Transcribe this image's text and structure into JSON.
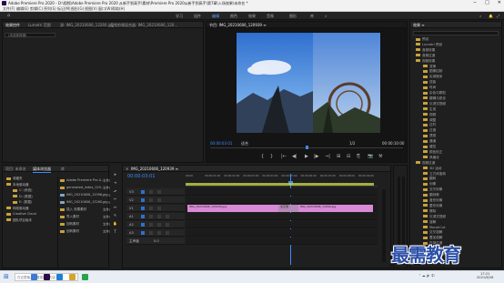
{
  "window": {
    "title": "Adobe Premiere Pro 2020 - D:\\视频\\Adobe Premiere Pro 2020 从新手到高手\\素材\\Premiere Pro 2020从新手到高手\\第7章\\入场效果\\未命名 *"
  },
  "menu": [
    "文件(F)",
    "编辑(E)",
    "剪辑(C)",
    "序列(S)",
    "标记(M)",
    "图形(G)",
    "视图(V)",
    "窗口(W)",
    "帮助(H)"
  ],
  "workspaces": [
    "学习",
    "组件",
    "编辑",
    "颜色",
    "效果",
    "音频",
    "图形",
    "库"
  ],
  "workspaces_more": "»",
  "source_panel": {
    "tabs": [
      "效果控件",
      "Lumetri 范围",
      "源: IMG_20210606_13260.jpg",
      "音频剪辑混合器: IMG_20210606_120..."
    ],
    "placeholder": "(未选择剪辑)"
  },
  "program_monitor": {
    "title": "节目: IMG_20210606_120939 ≡",
    "timecode_left": "00:00:03:01",
    "fit": "适合",
    "ratio": "1/2",
    "timecode_right": "00:00:10:00"
  },
  "transport": [
    "{",
    "}",
    "|←",
    "◀|",
    "▶",
    "|▶",
    "→|",
    "⊞",
    "⊟",
    "⎘",
    "📷",
    "⚒"
  ],
  "project_panel": {
    "tabs": [
      "项目: 未命名",
      "媒体浏览器",
      "库"
    ],
    "sidebar": [
      "收藏夹",
      "本地驱动器",
      "C: (系统)",
      "D: (数据)",
      "E: (数据)",
      "网络驱动器",
      "Creative Cloud",
      "团队项目版本"
    ],
    "files": [
      {
        "name": "Adobe Premiere Pro A...",
        "type": "文件夹"
      },
      {
        "name": "generated_index_120...",
        "type": "文件夹"
      },
      {
        "name": "IMG_20210606_12096...",
        "type": "JPEG"
      },
      {
        "name": "IMG_20210606_13260...",
        "type": "JPEG"
      },
      {
        "name": "插入 效果素材",
        "type": "文件夹"
      },
      {
        "name": "导入素材",
        "type": "文件夹"
      },
      {
        "name": "回转素材",
        "type": "文件夹"
      },
      {
        "name": "回转素材",
        "type": "文件夹"
      }
    ],
    "col_type": "文件夹"
  },
  "timeline": {
    "tab": "IMG_20210606_120939 ≡",
    "timecode": "00:00:03:01",
    "ruler": [
      "00:00",
      "00:00:01:00",
      "00:00:02:00",
      "00:00:03:00",
      "00:00:04:00",
      "00:00:05:00",
      "00:00:06:00",
      "00:00:07:00",
      "00:00:08:00",
      "00:00:09:00"
    ],
    "tracks": [
      "V3",
      "V2",
      "V1",
      "A1",
      "A2",
      "A3",
      "主声道"
    ],
    "master_value": "0.0",
    "clips": [
      {
        "label": "IMG_20210606_120939.jpg",
        "track": "V1"
      },
      {
        "label": "IMG_20210606_13260.jpg",
        "track": "V1"
      }
    ],
    "transition_label": "交叉溶"
  },
  "effects_panel": {
    "title": "效果 ≡",
    "items": [
      "预设",
      "Lumetri 预设",
      "音频效果",
      "音频过渡",
      "视频效果",
      "变换",
      "图像控制",
      "实用程序",
      "扭曲",
      "时间",
      "杂色与颗粒",
      "模糊与锐化",
      "沉浸式视频",
      "生成",
      "视频",
      "调整",
      "过时",
      "过渡",
      "透视",
      "通道",
      "键控",
      "颜色校正",
      "风格化",
      "视频过渡",
      "3D 运动",
      "立方体旋转",
      "翻转",
      "划像",
      "交叉划像",
      "圆划像",
      "盒形划像",
      "菱形划像",
      "擦除",
      "沉浸式视频",
      "溶解",
      "MorphCut",
      "交叉溶解",
      "叠加溶解",
      "白场过渡",
      "胶片溶解",
      "非叠加溶解",
      "黑场过渡"
    ]
  },
  "watermark": "最需教育",
  "taskbar": {
    "search": "在这里输入你要搜索的内容",
    "time": "17:21",
    "date": "2021/6/26"
  }
}
